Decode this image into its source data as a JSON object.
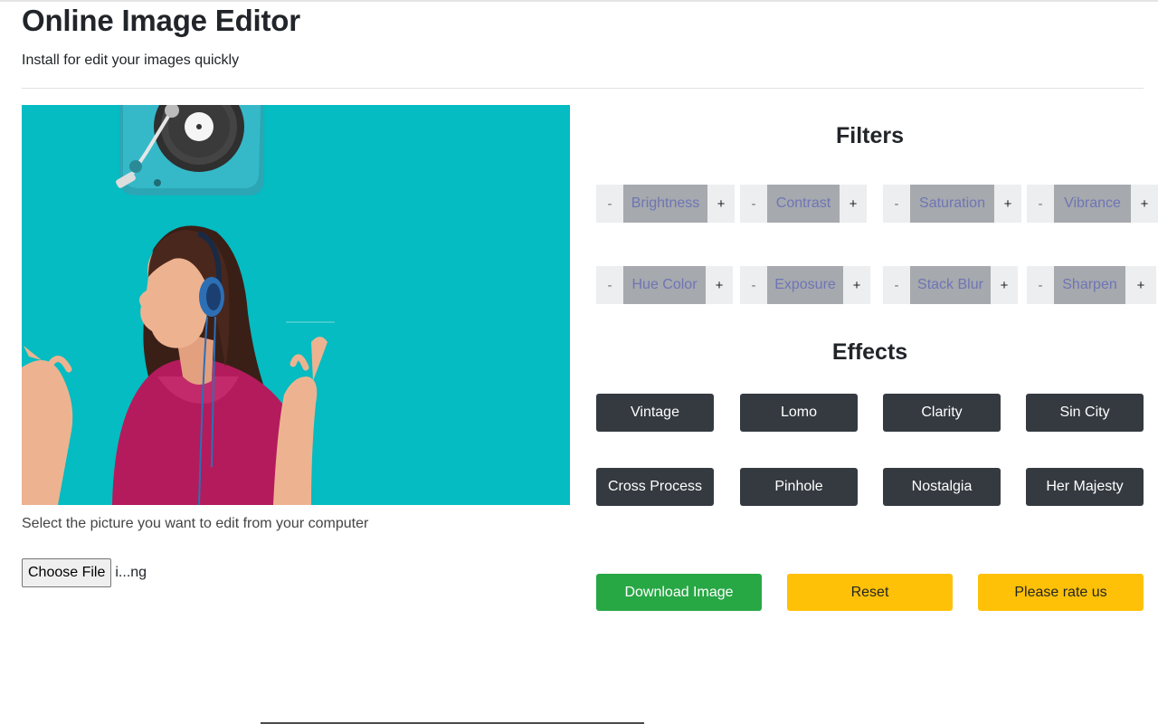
{
  "header": {
    "title": "Online Image Editor",
    "subtitle": "Install for edit your images quickly"
  },
  "preview": {
    "background_color": "#04bcc1",
    "image_description_icon": "woman-with-headphones-image"
  },
  "upload": {
    "hint": "Select the picture you want to edit from your computer",
    "choose_file_label": "Choose File",
    "file_name": "i...ng"
  },
  "filters": {
    "heading": "Filters",
    "minus_symbol": "-",
    "plus_symbol": "+",
    "items": [
      {
        "label": "Brightness"
      },
      {
        "label": "Contrast"
      },
      {
        "label": "Saturation"
      },
      {
        "label": "Vibrance"
      },
      {
        "label": "Hue Color"
      },
      {
        "label": "Exposure"
      },
      {
        "label": "Stack Blur"
      },
      {
        "label": "Sharpen"
      }
    ]
  },
  "effects": {
    "heading": "Effects",
    "items": [
      {
        "label": "Vintage"
      },
      {
        "label": "Lomo"
      },
      {
        "label": "Clarity"
      },
      {
        "label": "Sin City"
      },
      {
        "label": "Cross Process"
      },
      {
        "label": "Pinhole"
      },
      {
        "label": "Nostalgia"
      },
      {
        "label": "Her Majesty"
      }
    ]
  },
  "actions": {
    "download_label": "Download Image",
    "reset_label": "Reset",
    "rate_label": "Please rate us"
  },
  "colors": {
    "accent_dark": "#343a40",
    "download": "#28a745",
    "warning": "#ffc107",
    "filter_label_bg": "#a6a9ad",
    "filter_label_text": "#6f75b5"
  }
}
